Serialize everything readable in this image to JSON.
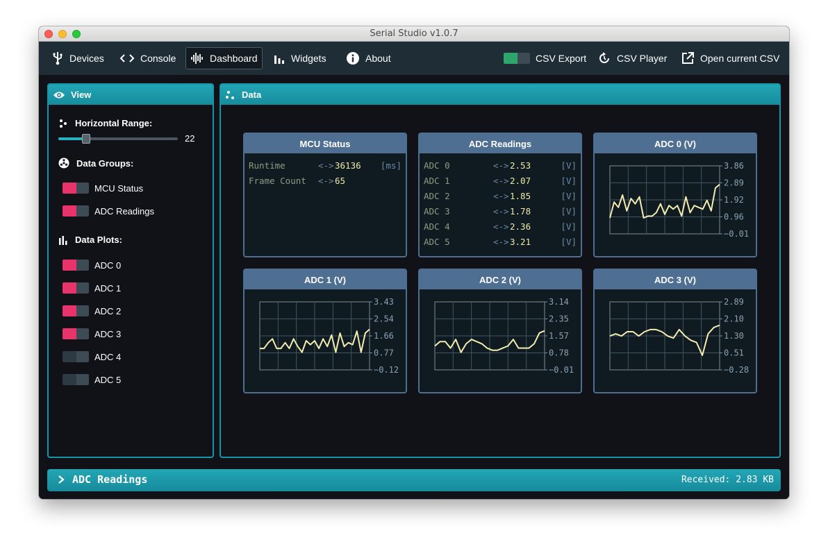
{
  "window": {
    "title": "Serial Studio v1.0.7"
  },
  "toolbar": {
    "devices": "Devices",
    "console": "Console",
    "dashboard": "Dashboard",
    "widgets": "Widgets",
    "about": "About",
    "csv_export": "CSV Export",
    "csv_player": "CSV Player",
    "open_csv": "Open current CSV"
  },
  "view": {
    "title": "View",
    "horizontal_range_label": "Horizontal Range:",
    "horizontal_range_value": "22",
    "horizontal_range_fraction": 0.23,
    "data_groups_label": "Data Groups:",
    "groups": [
      {
        "label": "MCU Status",
        "enabled": true
      },
      {
        "label": "ADC Readings",
        "enabled": true
      }
    ],
    "data_plots_label": "Data Plots:",
    "plots": [
      {
        "label": "ADC 0",
        "enabled": true
      },
      {
        "label": "ADC 1",
        "enabled": true
      },
      {
        "label": "ADC 2",
        "enabled": true
      },
      {
        "label": "ADC 3",
        "enabled": true
      },
      {
        "label": "ADC 4",
        "enabled": false
      },
      {
        "label": "ADC 5",
        "enabled": false
      }
    ]
  },
  "data": {
    "title": "Data",
    "mcu": {
      "title": "MCU Status",
      "rows": [
        {
          "label": "Runtime",
          "arrow": "<->",
          "value": "36136",
          "unit": "[ms]"
        },
        {
          "label": "Frame Count",
          "arrow": "<->",
          "value": "65",
          "unit": ""
        }
      ]
    },
    "adc": {
      "title": "ADC Readings",
      "rows": [
        {
          "label": "ADC 0",
          "arrow": "<->",
          "value": "2.53",
          "unit": "[V]"
        },
        {
          "label": "ADC 1",
          "arrow": "<->",
          "value": "2.07",
          "unit": "[V]"
        },
        {
          "label": "ADC 2",
          "arrow": "<->",
          "value": "1.85",
          "unit": "[V]"
        },
        {
          "label": "ADC 3",
          "arrow": "<->",
          "value": "1.78",
          "unit": "[V]"
        },
        {
          "label": "ADC 4",
          "arrow": "<->",
          "value": "2.36",
          "unit": "[V]"
        },
        {
          "label": "ADC 5",
          "arrow": "<->",
          "value": "3.21",
          "unit": "[V]"
        }
      ]
    }
  },
  "chart_data": [
    {
      "type": "line",
      "title": "ADC 0 (V)",
      "ylim": [
        -0.01,
        3.86
      ],
      "yticks": [
        "3.86",
        "2.89",
        "1.92",
        "0.96",
        "−0.01"
      ],
      "values": [
        0.9,
        1.8,
        1.5,
        2.2,
        1.3,
        2.0,
        1.7,
        2.1,
        0.9,
        1.0,
        1.0,
        1.2,
        1.7,
        1.1,
        1.6,
        1.4,
        1.6,
        1.0,
        2.1,
        1.2,
        1.6,
        1.5,
        1.4,
        1.9,
        1.3,
        2.6,
        2.8
      ],
      "grid": true
    },
    {
      "type": "line",
      "title": "ADC 1 (V)",
      "ylim": [
        -0.12,
        3.43
      ],
      "yticks": [
        "3.43",
        "2.54",
        "1.66",
        "0.77",
        "−0.12"
      ],
      "values": [
        1.0,
        1.0,
        1.3,
        1.5,
        1.0,
        1.0,
        1.3,
        1.0,
        1.5,
        1.1,
        0.8,
        1.4,
        1.2,
        1.4,
        1.0,
        1.5,
        1.1,
        1.7,
        0.8,
        1.8,
        1.1,
        1.3,
        1.2,
        1.9,
        0.8,
        1.8,
        2.0
      ],
      "grid": true
    },
    {
      "type": "line",
      "title": "ADC 2 (V)",
      "ylim": [
        -0.01,
        3.14
      ],
      "yticks": [
        "3.14",
        "2.35",
        "1.57",
        "0.78",
        "−0.01"
      ],
      "values": [
        1.1,
        1.3,
        1.3,
        1.0,
        1.4,
        0.8,
        1.2,
        1.4,
        1.3,
        1.2,
        1.0,
        0.9,
        0.9,
        1.0,
        1.1,
        1.4,
        1.0,
        1.0,
        1.0,
        1.2,
        1.7,
        1.8
      ],
      "grid": true
    },
    {
      "type": "line",
      "title": "ADC 3 (V)",
      "ylim": [
        -0.28,
        2.89
      ],
      "yticks": [
        "2.89",
        "2.10",
        "1.30",
        "0.51",
        "−0.28"
      ],
      "values": [
        1.3,
        1.4,
        1.3,
        1.5,
        1.5,
        1.3,
        1.5,
        1.6,
        1.6,
        1.5,
        1.3,
        1.2,
        1.6,
        1.3,
        1.1,
        1.0,
        0.4,
        1.4,
        1.7,
        1.8
      ],
      "grid": true
    }
  ],
  "status": {
    "title": "ADC Readings",
    "received": "Received: 2.83 KB"
  }
}
